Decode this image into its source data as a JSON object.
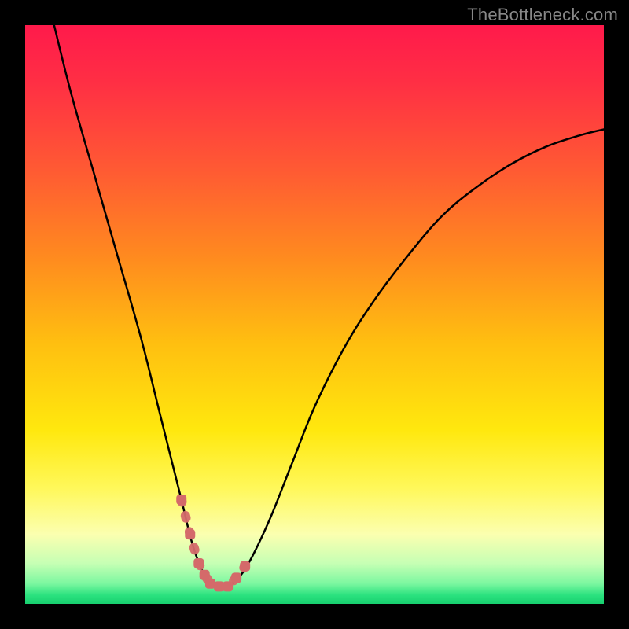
{
  "watermark": "TheBottleneck.com",
  "colors": {
    "page_bg": "#000000",
    "curve_stroke": "#000000",
    "marker_stroke": "#d46a6a",
    "marker_fill": "#d46a6a",
    "gradient_stops": [
      {
        "offset": 0.0,
        "color": "#ff1a4b"
      },
      {
        "offset": 0.1,
        "color": "#ff2f44"
      },
      {
        "offset": 0.25,
        "color": "#ff5a33"
      },
      {
        "offset": 0.4,
        "color": "#ff8a1f"
      },
      {
        "offset": 0.55,
        "color": "#ffbf10"
      },
      {
        "offset": 0.7,
        "color": "#ffe80e"
      },
      {
        "offset": 0.8,
        "color": "#fff85a"
      },
      {
        "offset": 0.88,
        "color": "#fbffb0"
      },
      {
        "offset": 0.93,
        "color": "#c6ffb4"
      },
      {
        "offset": 0.965,
        "color": "#7cf7a0"
      },
      {
        "offset": 0.985,
        "color": "#2be27f"
      },
      {
        "offset": 1.0,
        "color": "#17d06f"
      }
    ],
    "watermark_text": "#888888"
  },
  "chart_data": {
    "type": "line",
    "title": "",
    "xlabel": "",
    "ylabel": "",
    "xlim": [
      0,
      100
    ],
    "ylim": [
      0,
      100
    ],
    "series": [
      {
        "name": "bottleneck-curve",
        "x": [
          5,
          8,
          12,
          16,
          20,
          23,
          25,
          27,
          29,
          31,
          33,
          35,
          38,
          42,
          46,
          50,
          55,
          60,
          66,
          72,
          78,
          84,
          90,
          96,
          100
        ],
        "y": [
          100,
          88,
          74,
          60,
          46,
          34,
          26,
          18,
          10,
          5,
          3,
          3,
          6,
          14,
          24,
          34,
          44,
          52,
          60,
          67,
          72,
          76,
          79,
          81,
          82
        ]
      }
    ],
    "markers": {
      "name": "highlight-segment",
      "x": [
        27.0,
        28.5,
        30.0,
        31.0,
        32.0,
        33.5,
        35.0,
        36.5,
        38.0
      ],
      "y": [
        18.0,
        12.0,
        7.0,
        5.0,
        3.5,
        3.0,
        3.0,
        4.5,
        6.5
      ]
    }
  }
}
